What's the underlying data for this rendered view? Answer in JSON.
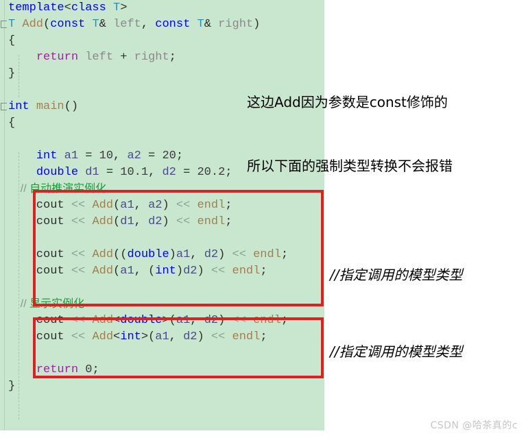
{
  "theme": {
    "code_background": "#c9e7ce",
    "page_background": "#ffffff",
    "highlight_box_color": "#e02020",
    "keyword_blue": "#0000ff",
    "type_teal": "#2b91af",
    "keyword_purple": "#a31fa3",
    "function_tan": "#a08050",
    "comment_green": "#1f9b3f",
    "identifier_gray": "#8a8a8a",
    "watermark_color": "#c6c6c6"
  },
  "code": {
    "language": "cpp",
    "lines": [
      {
        "id": "l01",
        "fold": false,
        "indent": 1,
        "text": "template<class T>"
      },
      {
        "id": "l02",
        "fold": true,
        "indent": 0,
        "text": "T Add(const T& left, const T& right)"
      },
      {
        "id": "l03",
        "fold": false,
        "indent": 1,
        "text": "{"
      },
      {
        "id": "l04",
        "fold": false,
        "indent": 2,
        "text": "    return left + right;"
      },
      {
        "id": "l05",
        "fold": false,
        "indent": 1,
        "text": "}"
      },
      {
        "id": "l06",
        "fold": false,
        "indent": 0,
        "text": ""
      },
      {
        "id": "l07",
        "fold": true,
        "indent": 0,
        "text": "int main()"
      },
      {
        "id": "l08",
        "fold": false,
        "indent": 1,
        "text": "{"
      },
      {
        "id": "l09",
        "fold": false,
        "indent": 0,
        "text": ""
      },
      {
        "id": "l10",
        "fold": false,
        "indent": 2,
        "text": "    int a1 = 10, a2 = 20;"
      },
      {
        "id": "l11",
        "fold": false,
        "indent": 2,
        "text": "    double d1 = 10.1, d2 = 20.2;"
      },
      {
        "id": "l12",
        "fold": false,
        "indent": 2,
        "text": "    // 自动推演实例化"
      },
      {
        "id": "l13",
        "fold": false,
        "indent": 2,
        "text": "    cout << Add(a1, a2) << endl;"
      },
      {
        "id": "l14",
        "fold": false,
        "indent": 2,
        "text": "    cout << Add(d1, d2) << endl;"
      },
      {
        "id": "l15",
        "fold": false,
        "indent": 0,
        "text": ""
      },
      {
        "id": "l16",
        "fold": false,
        "indent": 2,
        "text": "    cout << Add((double)a1, d2) << endl;"
      },
      {
        "id": "l17",
        "fold": false,
        "indent": 2,
        "text": "    cout << Add(a1, (int)d2) << endl;"
      },
      {
        "id": "l18",
        "fold": false,
        "indent": 0,
        "text": ""
      },
      {
        "id": "l19",
        "fold": false,
        "indent": 2,
        "text": "    // 显示实例化"
      },
      {
        "id": "l20",
        "fold": false,
        "indent": 2,
        "text": "    cout << Add<double>(a1, d2) << endl;"
      },
      {
        "id": "l21",
        "fold": false,
        "indent": 2,
        "text": "    cout << Add<int>(a1, d2) << endl;"
      },
      {
        "id": "l22",
        "fold": false,
        "indent": 0,
        "text": ""
      },
      {
        "id": "l23",
        "fold": false,
        "indent": 2,
        "text": "    return 0;"
      },
      {
        "id": "l24",
        "fold": false,
        "indent": 1,
        "text": "}"
      }
    ]
  },
  "highlight_boxes": [
    {
      "id": "auto-deduction",
      "label": "自动推演实例化 block"
    },
    {
      "id": "explicit-instantiation",
      "label": "显示实例化 block"
    }
  ],
  "annotations": {
    "top": {
      "line1": "这边Add因为参数是const修饰的",
      "line2": "所以下面的强制类型转换不会报错"
    },
    "right_first": "//指定调用的模型类型",
    "right_second": "//指定调用的模型类型"
  },
  "watermark": {
    "text": "CSDN @哈茶真的c"
  }
}
